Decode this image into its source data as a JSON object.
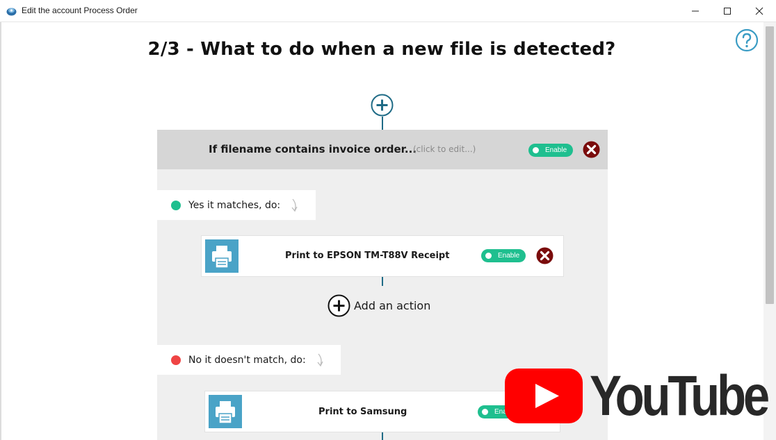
{
  "window": {
    "title": "Edit the account Process Order"
  },
  "page": {
    "title": "2/3 - What to do when a new file is detected?"
  },
  "rule": {
    "condition_text": "If filename contains invoice order...",
    "edit_hint": "(click to edit...)",
    "toggle_label": "Enable"
  },
  "branches": {
    "yes": {
      "label": "Yes it matches, do:",
      "dot_color": "#1fbf8f",
      "actions": [
        {
          "label": "Print to EPSON TM-T88V Receipt",
          "toggle_label": "Enable"
        }
      ]
    },
    "no": {
      "label": "No it doesn't match, do:",
      "dot_color": "#ef4444",
      "actions": [
        {
          "label": "Print to Samsung",
          "toggle_label": "Ena"
        }
      ]
    }
  },
  "add_action": {
    "label": "Add an action"
  },
  "overlay": {
    "brand": "YouTube"
  },
  "colors": {
    "accent": "#1f6b86",
    "enable_green": "#1fbf8f",
    "delete_red": "#7a0c0c",
    "printer_blue": "#4aa3c7",
    "youtube_red": "#ff0000"
  },
  "icons": {
    "help": "help-icon",
    "add": "plus-circle-icon",
    "delete": "close-circle-icon",
    "printer": "printer-icon"
  }
}
